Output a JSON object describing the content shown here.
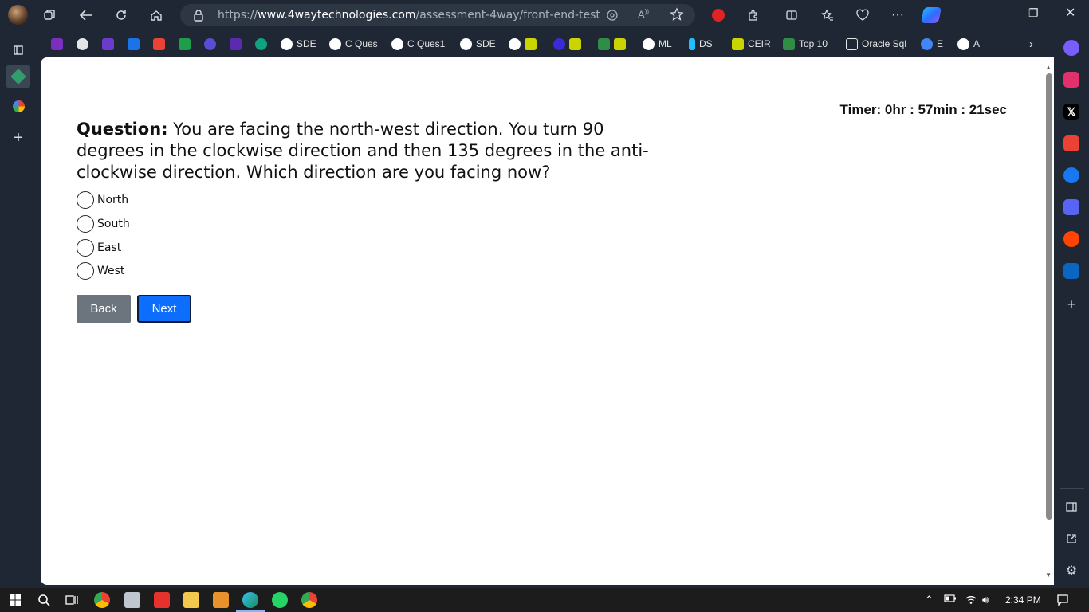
{
  "browser": {
    "url_prefix": "https://",
    "url_domain": "www.4waytechnologies.com",
    "url_path": "/assessment-4way/front-end-test"
  },
  "bookmarks": [
    {
      "label": "SDE"
    },
    {
      "label": "C Ques"
    },
    {
      "label": "C Ques1"
    },
    {
      "label": "SDE"
    },
    {
      "label": "ML"
    },
    {
      "label": "DS"
    },
    {
      "label": "CEIR"
    },
    {
      "label": "Top 10"
    },
    {
      "label": "Oracle Sql"
    },
    {
      "label": "E"
    },
    {
      "label": "A"
    }
  ],
  "quiz": {
    "timer": "Timer: 0hr : 57min : 21sec",
    "question_label": "Question:",
    "question_text": " You are facing the north-west direction. You turn 90 degrees in the clockwise direction and then 135 degrees in the anti-clockwise direction. Which direction are you facing now?",
    "options": [
      "North",
      "South",
      "East",
      "West"
    ],
    "back_label": "Back",
    "next_label": "Next"
  },
  "taskbar": {
    "time": "2:34 PM"
  },
  "colors": {
    "next_button": "#0d6efd",
    "back_button": "#6c757d",
    "browser_chrome": "#1e2733"
  }
}
